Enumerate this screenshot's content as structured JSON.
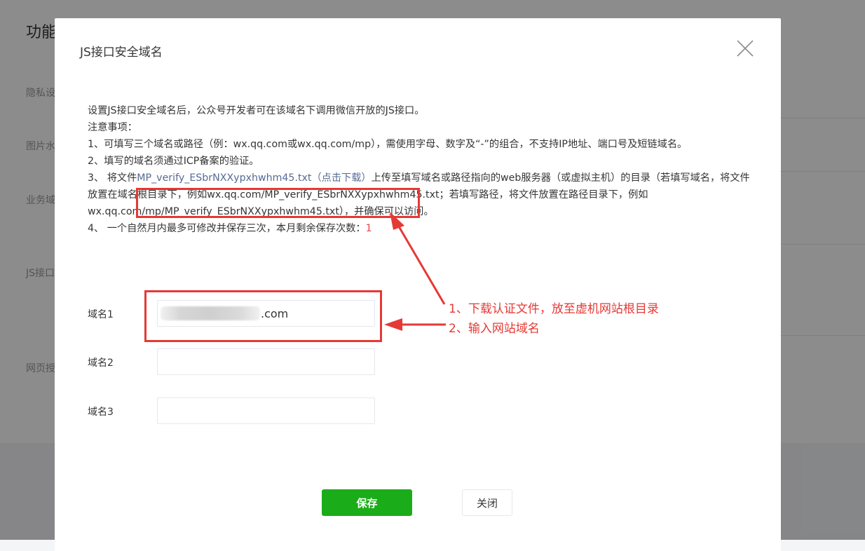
{
  "background": {
    "title": "功能",
    "items": [
      "隐私设",
      "图片水",
      "业务域",
      "JS接口",
      "网页授"
    ]
  },
  "dialog": {
    "title": "JS接口安全域名",
    "close_icon": "close-icon",
    "intro": "设置JS接口安全域名后，公众号开发者可在该域名下调用微信开放的JS接口。",
    "notes_heading": "注意事项：",
    "note1": "1、可填写三个域名或路径（例：wx.qq.com或wx.qq.com/mp），需使用字母、数字及“-”的组合，不支持IP地址、端口号及短链域名。",
    "note2": "2、填写的域名须通过ICP备案的验证。",
    "note3_prefix": "3、 将文件",
    "note3_link": "MP_verify_ESbrNXXypxhwhm45.txt（点击下载）",
    "note3_suffix": "上传至填写域名或路径指向的web服务器（或虚拟主机）的目录（若填写域名，将文件放置在域名根目录下，例如wx.qq.com/MP_verify_ESbrNXXypxhwhm45.txt；若填写路径，将文件放置在路径目录下，例如wx.qq.com/mp/MP_verify_ESbrNXXypxhwhm45.txt），并确保可以访问。",
    "note4_prefix": "4、 一个自然月内最多可修改并保存三次，本月剩余保存次数：",
    "note4_count": "1",
    "fields": [
      {
        "label": "域名1",
        "value": ".com"
      },
      {
        "label": "域名2",
        "value": ""
      },
      {
        "label": "域名3",
        "value": ""
      }
    ],
    "save_label": "保存",
    "close_label": "关闭"
  },
  "annotations": {
    "line1": "1、下载认证文件，放至虚机网站根目录",
    "line2": "2、输入网站域名",
    "color": "#e53935"
  }
}
